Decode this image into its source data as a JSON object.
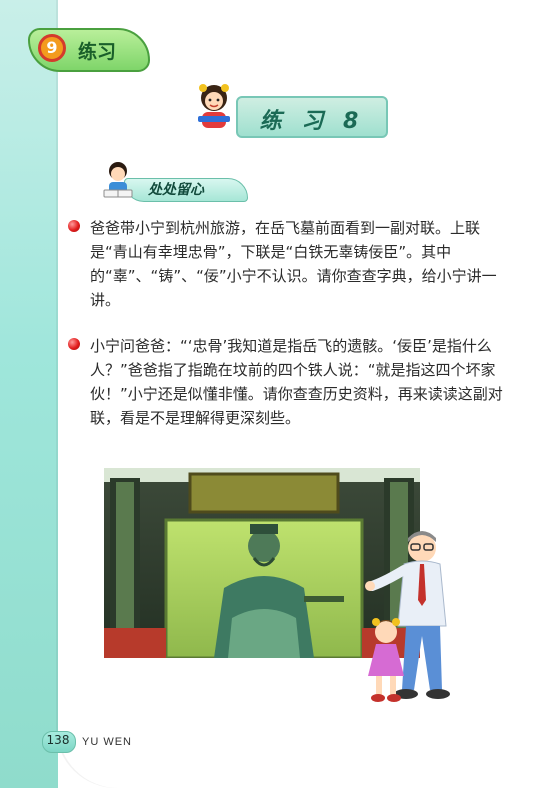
{
  "section_tab": {
    "label": "练习",
    "badge": "9"
  },
  "title": {
    "text": "练 习 8"
  },
  "sub_heading": {
    "label": "处处留心"
  },
  "paragraphs": [
    {
      "text": "爸爸带小宁到杭州旅游，在岳飞墓前面看到一副对联。上联是“青山有幸埋忠骨”，下联是“白铁无辜铸佞臣”。其中的“辜”、“铸”、“佞”小宁不认识。请你查查字典，给小宁讲一讲。"
    },
    {
      "text": "小宁问爸爸：“‘忠骨’我知道是指岳飞的遗骸。‘佞臣’是指什么人？”爸爸指了指跪在坟前的四个铁人说：“就是指这四个坏家伙！”小宁还是似懂非懂。请你查查历史资料，再来读读这副对联，看是不是理解得更深刻些。"
    }
  ],
  "footer": {
    "page_number": "138",
    "subject": "YU WEN"
  },
  "colors": {
    "side_band": "#9fe6db",
    "tab_green": "#7fd56a",
    "bullet_red": "#e21d1d",
    "title_teal": "#1b6a55"
  }
}
